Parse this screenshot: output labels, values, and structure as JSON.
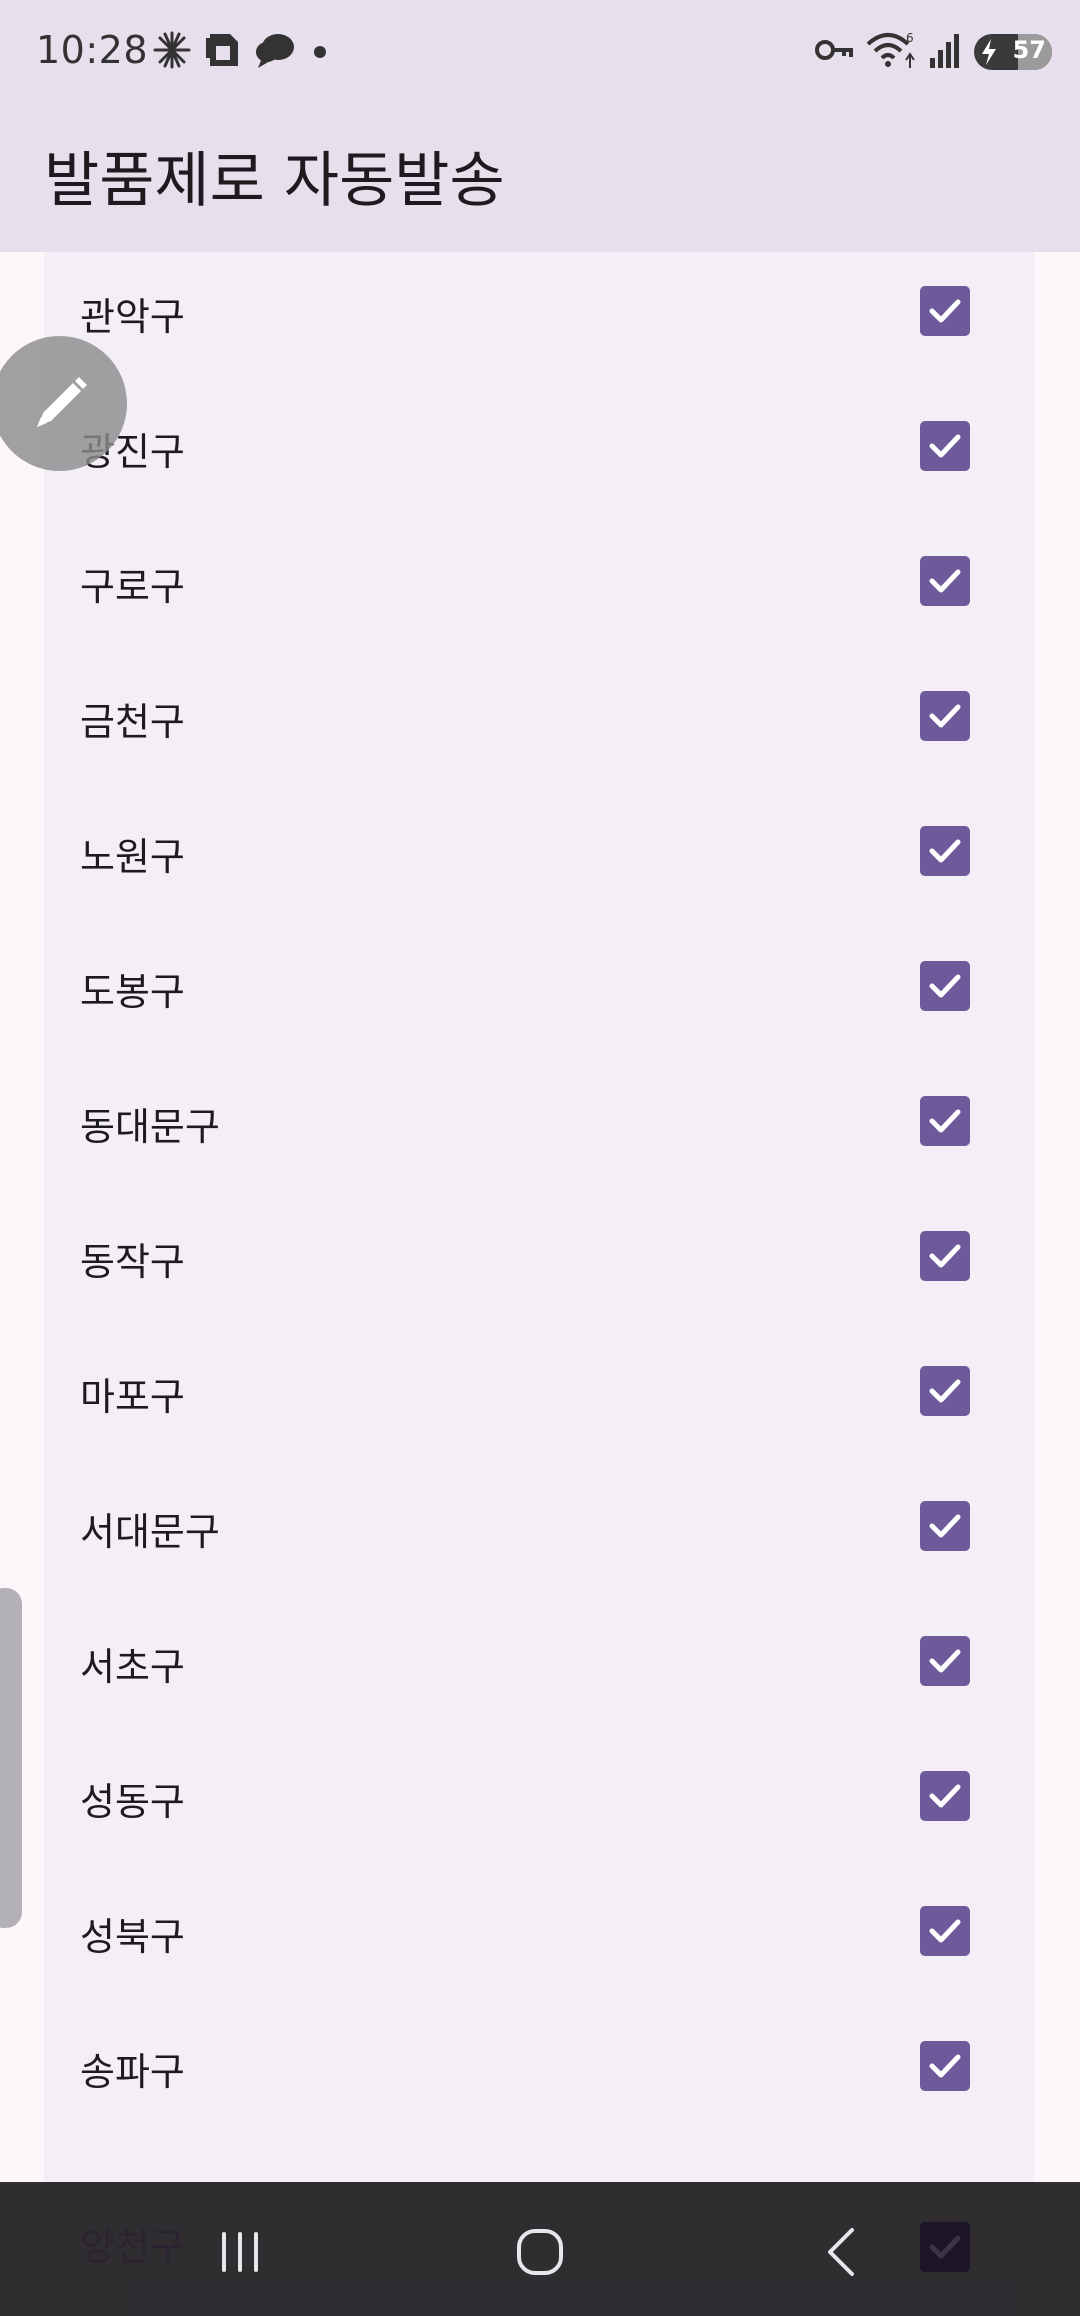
{
  "status_bar": {
    "time": "10:28",
    "battery_level": "57",
    "left_icons": [
      "pinwheel-icon",
      "sim-card-icon",
      "chat-bubble-icon",
      "dot-icon"
    ],
    "right_icons": [
      "vpn-key-icon",
      "wifi-icon",
      "signal-icon",
      "battery-icon"
    ]
  },
  "app_bar": {
    "title": "발품제로 자동발송"
  },
  "colors": {
    "accent": "#6e5a9a",
    "app_bar_bg": "#e7dfec",
    "list_bg": "#f4eff7",
    "nav_bg": "#262428"
  },
  "districts": [
    {
      "label": "관악구",
      "checked": true
    },
    {
      "label": "광진구",
      "checked": true
    },
    {
      "label": "구로구",
      "checked": true
    },
    {
      "label": "금천구",
      "checked": true
    },
    {
      "label": "노원구",
      "checked": true
    },
    {
      "label": "도봉구",
      "checked": true
    },
    {
      "label": "동대문구",
      "checked": true
    },
    {
      "label": "동작구",
      "checked": true
    },
    {
      "label": "마포구",
      "checked": true
    },
    {
      "label": "서대문구",
      "checked": true
    },
    {
      "label": "서초구",
      "checked": true
    },
    {
      "label": "성동구",
      "checked": true
    },
    {
      "label": "성북구",
      "checked": true
    },
    {
      "label": "송파구",
      "checked": true
    },
    {
      "label": "양천구",
      "checked": true
    }
  ],
  "nav_bar": {
    "buttons": [
      "recent-apps-icon",
      "home-icon",
      "back-icon"
    ]
  }
}
